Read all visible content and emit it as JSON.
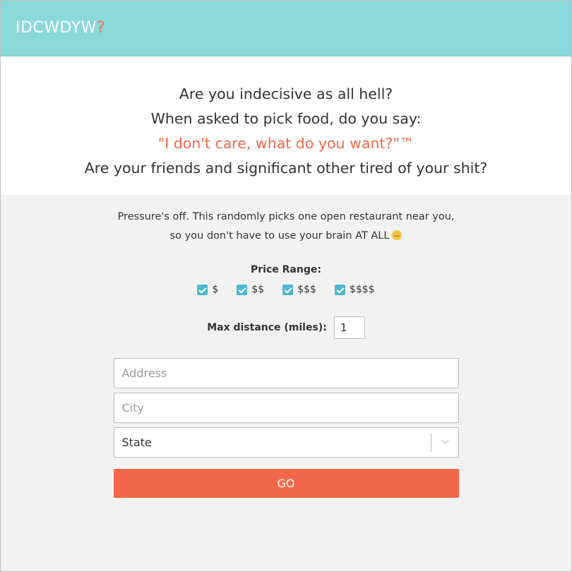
{
  "header": {
    "brand": "IDCWDYW",
    "brand_accent": "?"
  },
  "hero": {
    "line1": "Are you indecisive as all hell?",
    "line2": "When asked to pick food, do you say:",
    "quote": "\"I don't care, what do you want?\"™",
    "line4": "Are your friends and significant other tired of your shit?"
  },
  "blurb": {
    "line1": "Pressure's off. This randomly picks one open restaurant near you,",
    "line2": "so you don't have to use your brain AT ALL",
    "emoji_icon": "grimace-emoji-icon"
  },
  "price": {
    "label": "Price Range:",
    "options": [
      {
        "label": "$",
        "checked": true
      },
      {
        "label": "$$",
        "checked": true
      },
      {
        "label": "$$$",
        "checked": true
      },
      {
        "label": "$$$$",
        "checked": true
      }
    ]
  },
  "distance": {
    "label": "Max distance (miles):",
    "value": "1"
  },
  "form": {
    "address_placeholder": "Address",
    "city_placeholder": "City",
    "state_value": "State",
    "go_label": "GO"
  },
  "colors": {
    "header_bg": "#8ad9da",
    "accent": "#f26849",
    "checkbox": "#4fb7d3"
  }
}
